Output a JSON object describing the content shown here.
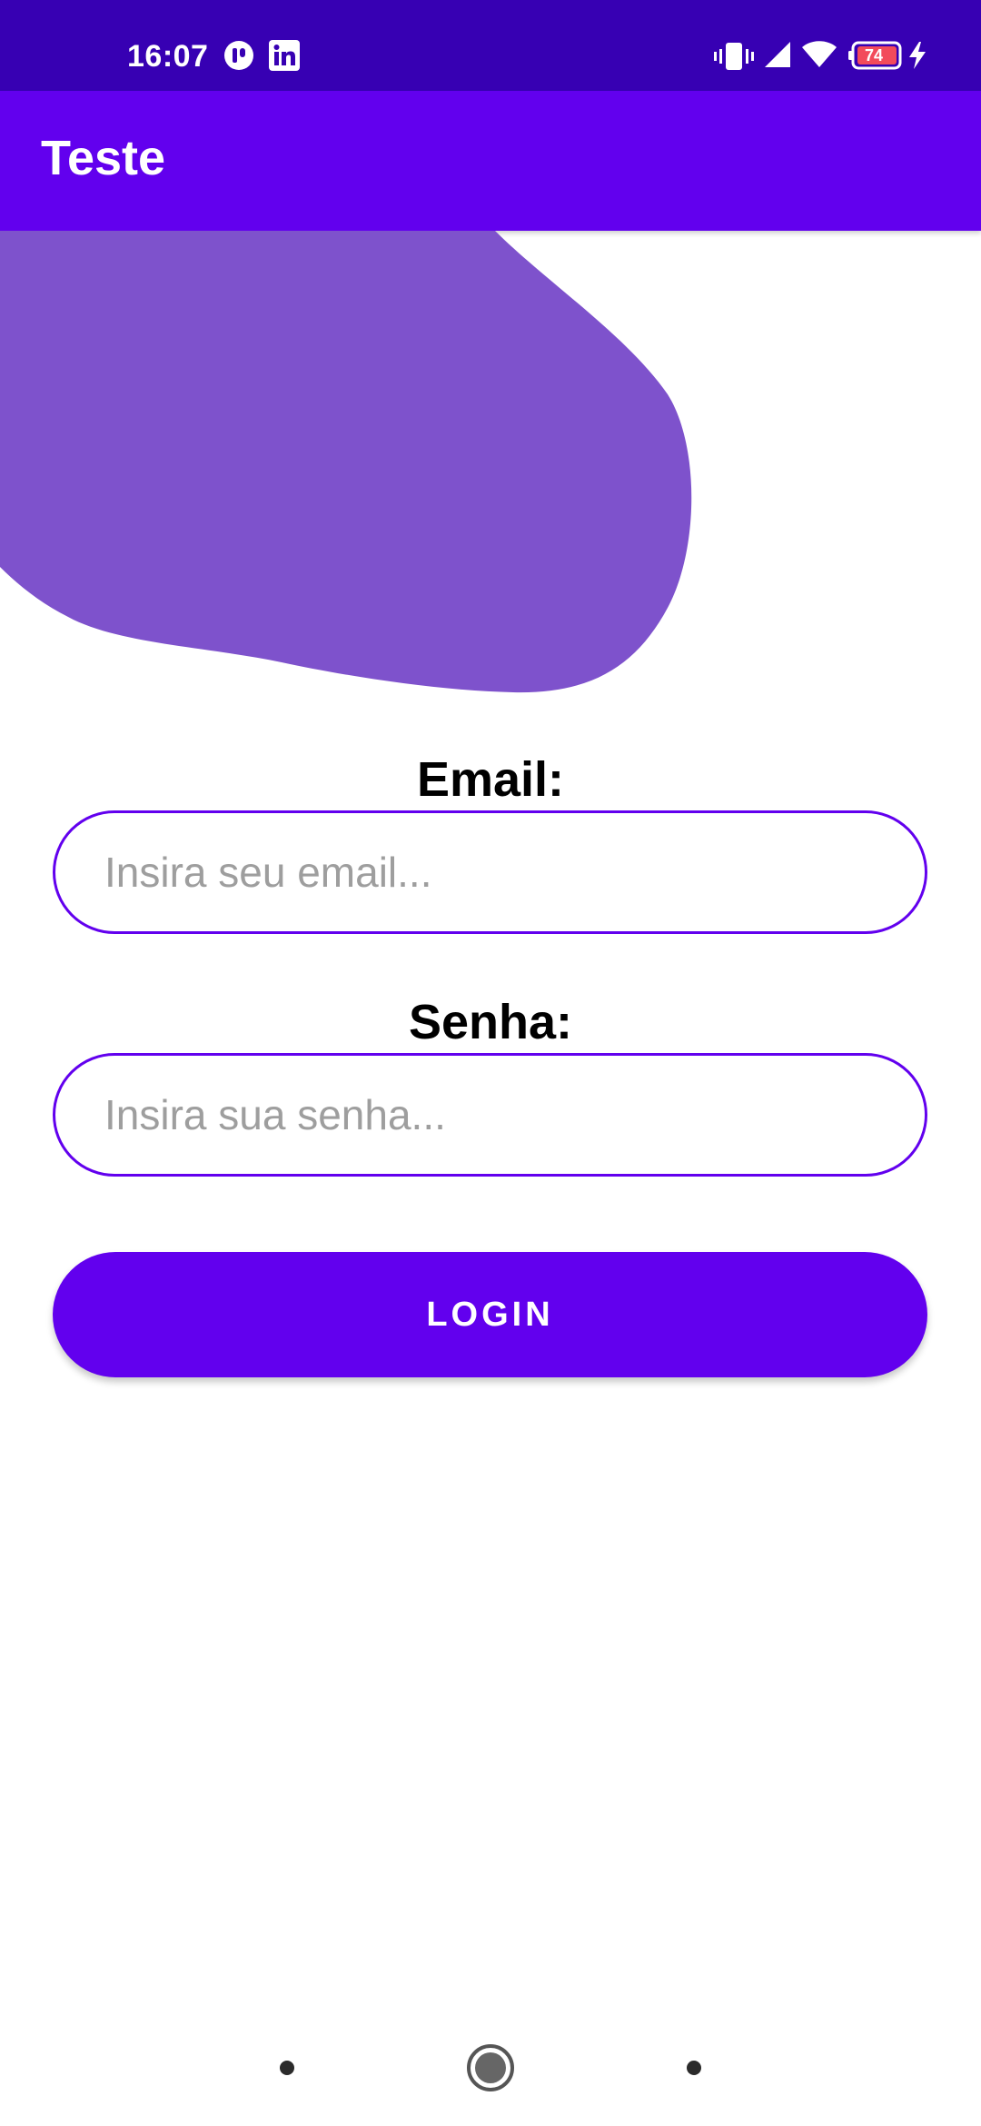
{
  "status_bar": {
    "time": "16:07",
    "left_icons": [
      "app-notification-icon",
      "linkedin-icon"
    ],
    "right_icons": [
      "vibrate-icon",
      "signal-icon",
      "wifi-icon",
      "battery-icon",
      "charging-icon"
    ],
    "battery_level": "74"
  },
  "app_bar": {
    "title": "Teste"
  },
  "form": {
    "email_label": "Email:",
    "email_placeholder": "Insira seu email...",
    "password_label": "Senha:",
    "password_placeholder": "Insira sua senha...",
    "login_label": "LOGIN"
  },
  "nav_bar": {
    "buttons": [
      "back-button",
      "home-button",
      "recents-button"
    ]
  },
  "colors": {
    "status_bar": "#3700b3",
    "primary": "#6200ee",
    "blob": "#7e52cc",
    "placeholder": "#9e9e9e"
  }
}
